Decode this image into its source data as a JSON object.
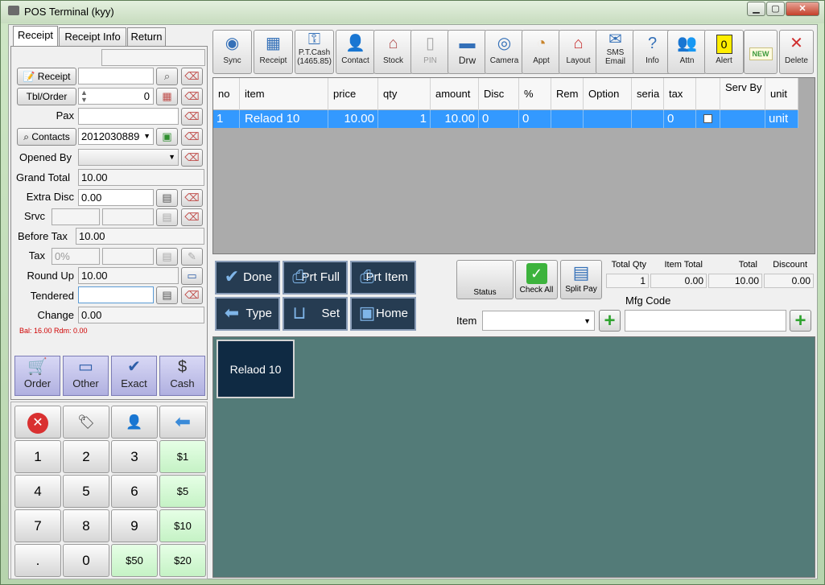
{
  "window": {
    "title": "POS Terminal (kyy)",
    "min": "▁",
    "max": "▢",
    "close": "✕"
  },
  "tabs": [
    {
      "label": "Receipt"
    },
    {
      "label": "Receipt Info"
    },
    {
      "label": "Return"
    }
  ],
  "left": {
    "receipt_btn": "Receipt",
    "tbl_btn": "Tbl/Order",
    "tbl_value": "0",
    "pax": "Pax",
    "contacts_btn": "Contacts",
    "contacts_value": "2012030889",
    "opened_by": "Opened By",
    "grand_total_lbl": "Grand Total",
    "grand_total": "10.00",
    "extra_disc_lbl": "Extra Disc",
    "extra_disc": "0.00",
    "srvc_lbl": "Srvc",
    "before_tax_lbl": "Before Tax",
    "before_tax": "10.00",
    "tax_lbl": "Tax",
    "tax_placeholder": "0%",
    "round_up_lbl": "Round Up",
    "round_up": "10.00",
    "tendered_lbl": "Tendered",
    "change_lbl": "Change",
    "change": "0.00",
    "bal": "Bal: 16.00 Rdm: 0.00"
  },
  "payment": [
    {
      "label": "Order",
      "icon": "cart-icon"
    },
    {
      "label": "Other",
      "icon": "card-icon"
    },
    {
      "label": "Exact",
      "icon": "check-icon"
    },
    {
      "label": "Cash",
      "icon": "dollar-icon"
    }
  ],
  "keypad": {
    "row2": [
      "1",
      "2",
      "3",
      "$1"
    ],
    "row3": [
      "4",
      "5",
      "6",
      "$5"
    ],
    "row4": [
      "7",
      "8",
      "9",
      "$10"
    ],
    "row5": [
      ".",
      "0",
      "$50",
      "$20"
    ]
  },
  "toolbar": [
    {
      "label": "Sync"
    },
    {
      "label": "Receipt"
    },
    {
      "label": "P.T.Cash\n(1465.85)"
    },
    {
      "label": "Contact"
    },
    {
      "label": "Stock"
    },
    {
      "label": "PIN"
    },
    {
      "label": "Drw"
    },
    {
      "label": "Camera"
    },
    {
      "label": "Appt"
    },
    {
      "label": "Layout"
    },
    {
      "label": "SMS\nEmail"
    },
    {
      "label": "Info"
    },
    {
      "label": "Attn"
    },
    {
      "label": "Alert"
    },
    {
      "label": ""
    },
    {
      "label": "Delete"
    }
  ],
  "toolbar_extra": {
    "alert_count": "0",
    "new_badge": "NEW"
  },
  "grid": {
    "headers": [
      "no",
      "item",
      "price",
      "qty",
      "amount",
      "Disc",
      "%",
      "Rem",
      "Option",
      "seria",
      "tax",
      "",
      "Serv By",
      "unit"
    ],
    "rows": [
      [
        "1",
        "Relaod 10",
        "10.00",
        "1",
        "10.00",
        "0",
        "0",
        "",
        "",
        "",
        "0",
        "",
        "",
        "unit"
      ]
    ]
  },
  "actions": {
    "done": "Done",
    "prt_full": "Prt Full",
    "prt_item": "Prt Item",
    "type": "Type",
    "set": "Set",
    "home": "Home"
  },
  "mid": {
    "status": "Status",
    "check_all": "Check All",
    "split_pay": "Split Pay",
    "item": "Item",
    "mfg_code": "Mfg Code"
  },
  "totals": {
    "total_qty_lbl": "Total Qty",
    "total_qty": "1",
    "item_total_lbl": "Item Total",
    "item_total": "0.00",
    "total_lbl": "Total",
    "total": "10.00",
    "discount_lbl": "Discount",
    "discount": "0.00"
  },
  "items": [
    {
      "label": "Relaod 10"
    }
  ]
}
